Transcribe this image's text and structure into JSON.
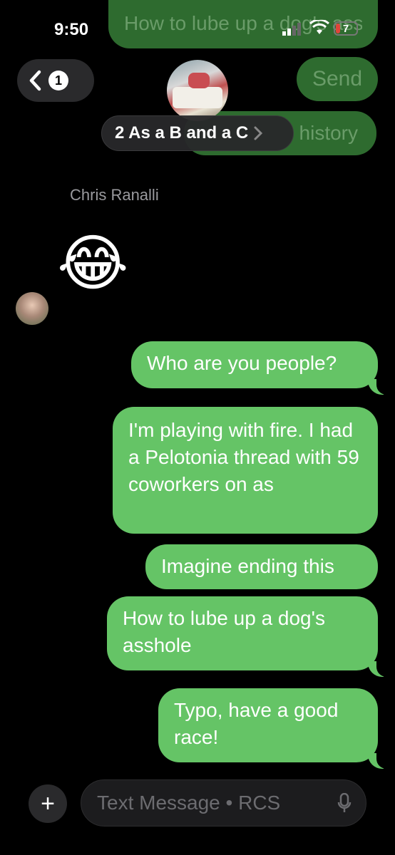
{
  "status_bar": {
    "time": "9:50",
    "battery": "7"
  },
  "header": {
    "back_count": "1",
    "send_label": "Send",
    "group_name": "2 As a B and a C",
    "behind_top_text": "How to lube up a dog's asshole",
    "behind_history_text": "history"
  },
  "thread": {
    "sender_name": "Chris Ranalli",
    "emoji": "😂",
    "messages": [
      "Who are you people?",
      "I'm playing with fire.  I had a Pelotonia thread with 59 coworkers on as",
      "Imagine ending this",
      "How to lube up a dog's asshole",
      "Typo, have a good race!"
    ]
  },
  "composer": {
    "placeholder": "Text Message • RCS"
  },
  "colors": {
    "bubble": "#65C466",
    "background": "#000000"
  }
}
